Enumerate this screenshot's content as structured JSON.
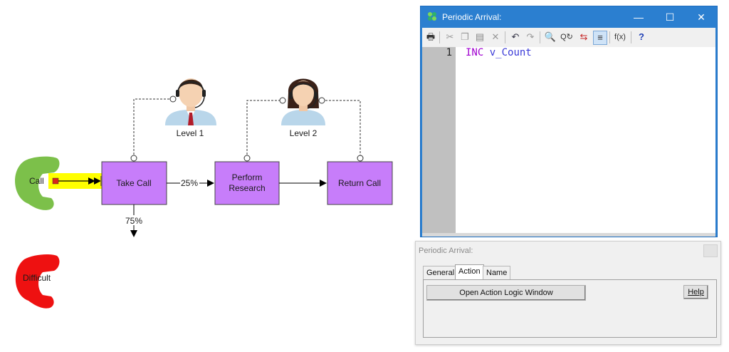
{
  "diagram": {
    "nodes": {
      "take_call": "Take Call",
      "perform_research": "Perform Research",
      "return_call": "Return Call"
    },
    "perform_research_lines": [
      "Perform",
      "Research"
    ],
    "sources": {
      "call": "Call",
      "difficult": "Difficult"
    },
    "resources": {
      "level1": "Level 1",
      "level2": "Level 2"
    },
    "edge_labels": {
      "to_research": "25%",
      "exit": "75%"
    },
    "colors": {
      "node_fill": "#c77dfa",
      "phone_green": "#7cc04a",
      "phone_red": "#ee1111",
      "highlight": "#ffff00"
    }
  },
  "editor": {
    "title": "Periodic Arrival:",
    "window_buttons": {
      "minimize": "—",
      "maximize": "☐",
      "close": "✕"
    },
    "toolbar_icons": [
      "print-icon",
      "cut-icon",
      "copy-icon",
      "paste-icon",
      "delete-icon",
      "undo-icon",
      "redo-icon",
      "find-icon",
      "replace-icon",
      "goto-icon",
      "format-icon",
      "function-icon",
      "help-icon"
    ],
    "lines": [
      {
        "number": "1",
        "keyword": "INC",
        "argument": "v_Count"
      }
    ]
  },
  "dialog": {
    "title": "Periodic Arrival:",
    "tabs": [
      "General",
      "Action",
      "Name"
    ],
    "active_tab": "Action",
    "open_logic_button": "Open Action Logic Window",
    "help_button": "Help"
  }
}
